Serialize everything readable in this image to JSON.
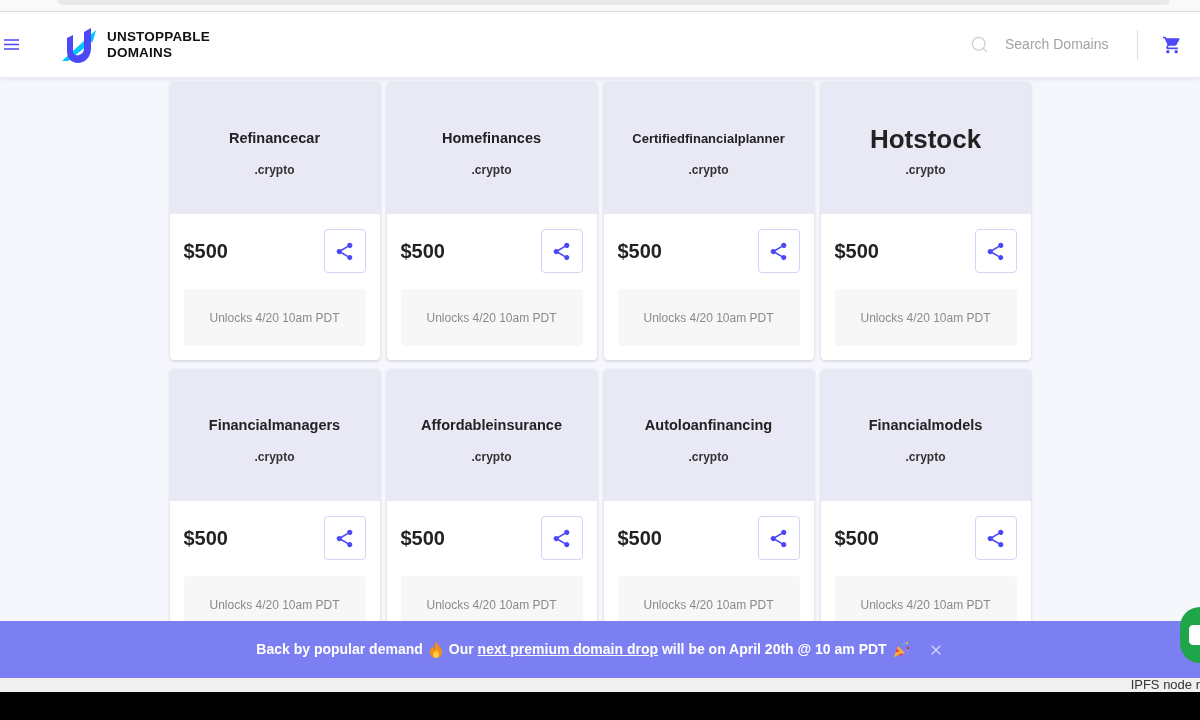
{
  "header": {
    "brand": "UNSTOPPABLE DOMAINS",
    "search": {
      "placeholder": "Search Domains"
    }
  },
  "domains": [
    {
      "name": "Refinancecar",
      "tld": ".crypto",
      "price": "$500",
      "status": "Unlocks 4/20 10am PDT"
    },
    {
      "name": "Homefinances",
      "tld": ".crypto",
      "price": "$500",
      "status": "Unlocks 4/20 10am PDT"
    },
    {
      "name": "Certifiedfinancialplanner",
      "tld": ".crypto",
      "price": "$500",
      "status": "Unlocks 4/20 10am PDT"
    },
    {
      "name": "Hotstock",
      "tld": ".crypto",
      "price": "$500",
      "status": "Unlocks 4/20 10am PDT"
    },
    {
      "name": "Financialmanagers",
      "tld": ".crypto",
      "price": "$500",
      "status": "Unlocks 4/20 10am PDT"
    },
    {
      "name": "Affordableinsurance",
      "tld": ".crypto",
      "price": "$500",
      "status": "Unlocks 4/20 10am PDT"
    },
    {
      "name": "Autoloanfinancing",
      "tld": ".crypto",
      "price": "$500",
      "status": "Unlocks 4/20 10am PDT"
    },
    {
      "name": "Financialmodels",
      "tld": ".crypto",
      "price": "$500",
      "status": "Unlocks 4/20 10am PDT"
    }
  ],
  "banner": {
    "lead": "Back by popular demand",
    "before_link": "Our",
    "link": "next premium domain drop",
    "after_link": "will be on April 20th @ 10 am PDT"
  },
  "status_bar": {
    "text": "IPFS node r"
  }
}
